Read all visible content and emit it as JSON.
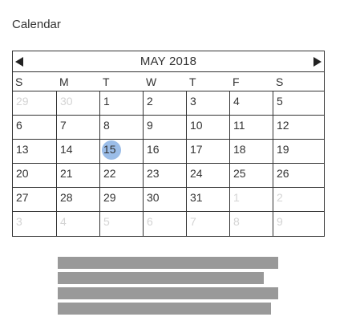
{
  "page": {
    "title": "Calendar"
  },
  "calendar": {
    "month_label": "MAY 2018",
    "prev_icon": "triangle-left-icon",
    "next_icon": "triangle-right-icon",
    "weekdays": [
      "S",
      "M",
      "T",
      "W",
      "T",
      "F",
      "S"
    ],
    "weeks": [
      [
        {
          "label": "29",
          "outside": true
        },
        {
          "label": "30",
          "outside": true
        },
        {
          "label": "1",
          "outside": false
        },
        {
          "label": "2",
          "outside": false
        },
        {
          "label": "3",
          "outside": false
        },
        {
          "label": "4",
          "outside": false
        },
        {
          "label": "5",
          "outside": false
        }
      ],
      [
        {
          "label": "6",
          "outside": false
        },
        {
          "label": "7",
          "outside": false
        },
        {
          "label": "8",
          "outside": false
        },
        {
          "label": "9",
          "outside": false
        },
        {
          "label": "10",
          "outside": false
        },
        {
          "label": "11",
          "outside": false
        },
        {
          "label": "12",
          "outside": false
        }
      ],
      [
        {
          "label": "13",
          "outside": false
        },
        {
          "label": "14",
          "outside": false
        },
        {
          "label": "15",
          "outside": false,
          "selected": true
        },
        {
          "label": "16",
          "outside": false
        },
        {
          "label": "17",
          "outside": false
        },
        {
          "label": "18",
          "outside": false
        },
        {
          "label": "19",
          "outside": false
        }
      ],
      [
        {
          "label": "20",
          "outside": false
        },
        {
          "label": "21",
          "outside": false
        },
        {
          "label": "22",
          "outside": false
        },
        {
          "label": "23",
          "outside": false
        },
        {
          "label": "24",
          "outside": false
        },
        {
          "label": "25",
          "outside": false
        },
        {
          "label": "26",
          "outside": false
        }
      ],
      [
        {
          "label": "27",
          "outside": false
        },
        {
          "label": "28",
          "outside": false
        },
        {
          "label": "29",
          "outside": false
        },
        {
          "label": "30",
          "outside": false
        },
        {
          "label": "31",
          "outside": false
        },
        {
          "label": "1",
          "outside": true
        },
        {
          "label": "2",
          "outside": true
        }
      ],
      [
        {
          "label": "3",
          "outside": true
        },
        {
          "label": "4",
          "outside": true
        },
        {
          "label": "5",
          "outside": true
        },
        {
          "label": "6",
          "outside": true
        },
        {
          "label": "7",
          "outside": true
        },
        {
          "label": "8",
          "outside": true
        },
        {
          "label": "9",
          "outside": true
        }
      ]
    ],
    "colors": {
      "border": "#333333",
      "text": "#333333",
      "outside_text": "#d4d4d4",
      "selected_fill": "#9bbde8"
    }
  },
  "redacted_text": {
    "color": "#999999",
    "line_count": 4
  }
}
